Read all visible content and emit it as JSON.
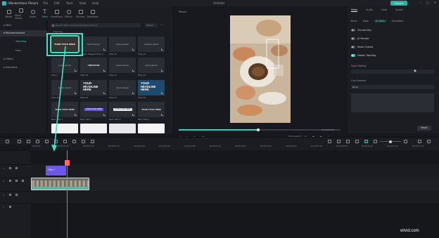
{
  "titlebar": {
    "app_name": "Wondershare Filmora",
    "menu": [
      "File",
      "Edit",
      "Tools",
      "View",
      "Help"
    ],
    "doc_title": "Untitled",
    "export_label": "Export"
  },
  "media_tabs": [
    {
      "label": "Media",
      "active": false
    },
    {
      "label": "Stock Media",
      "active": false
    },
    {
      "label": "Audio",
      "active": false
    },
    {
      "label": "Titles",
      "active": true
    },
    {
      "label": "Transitions",
      "active": false
    },
    {
      "label": "Effects",
      "active": false
    },
    {
      "label": "Stickers",
      "active": false
    },
    {
      "label": "Templates",
      "active": false
    }
  ],
  "left_panel": {
    "items": [
      "Mine",
      "Recommended",
      "Trending",
      "New",
      "Filters",
      "Elements"
    ],
    "selected": "Recommended",
    "active_sub": "Trending"
  },
  "library": {
    "search_placeholder": "Search titles from Wondershare Filmora",
    "price_filter": "Price",
    "section_header": "Trending",
    "thumbs": [
      {
        "caption": "YOUR TITLE HERE",
        "label": "",
        "selected": true
      },
      {
        "caption": "Lorem Ipsum",
        "label": "Classic Elegant Title 0...",
        "selected": false
      },
      {
        "caption": "Lorem ipsum",
        "label": "Title 33",
        "selected": false
      },
      {
        "caption": "+Dorem ipsum",
        "label": "Title_31",
        "selected": false
      },
      {
        "caption": "Lorem ipsum",
        "label": "Title_2",
        "selected": false
      },
      {
        "caption": "CREATION",
        "label": "Title 38",
        "selected": false
      },
      {
        "caption": "Lorem ipsum",
        "label": "Title 17",
        "selected": false
      },
      {
        "caption": "Lorem ipsum",
        "label": "Title_41",
        "selected": false
      },
      {
        "caption": "Lorem ipsum",
        "label": "Title 29",
        "selected": false
      },
      {
        "caption": "YOUR HEADLINE HERE",
        "label": "Title 46",
        "selected": false
      },
      {
        "caption": "Lorem ipsum",
        "label": "Title 44",
        "selected": false
      },
      {
        "caption": "YOUR HEADLINE HERE",
        "label": "Title 40",
        "selected": false
      },
      {
        "caption": "YOUR TITLE HERE",
        "label": "New Title 1",
        "selected": false
      },
      {
        "caption": "YOUR TITLE HERE",
        "label": "New Title 2",
        "selected": false
      },
      {
        "caption": "YOUR TITLE HERE",
        "label": "New Title 3",
        "selected": false
      },
      {
        "caption": "YOUR TITLE HERE",
        "label": "New Title 4",
        "selected": false
      }
    ]
  },
  "player": {
    "label": "Player",
    "time": "00:00:00:10",
    "quality": "Full Quality"
  },
  "properties": {
    "tabs": [
      "Video",
      "Audio",
      "Color",
      "Speed"
    ],
    "active_tab": "Video",
    "subtabs": [
      "Basic",
      "Mask",
      "AI Tools",
      "Animation"
    ],
    "active_subtab": "AI Tools",
    "rows": [
      "Chroma Key",
      "AI Portrait",
      "Smart Cutout",
      "Motion Tracking"
    ],
    "track_setting_label": "Track Setting",
    "link_element_label": "Link Element",
    "link_element_value": "None",
    "reset_label": "Reset"
  },
  "timeline": {
    "ruler_ticks": [
      "00:00:00",
      "00:00:00:10",
      "00:00:01:00",
      "00:00:01:10",
      "00:00:02:00",
      "00:00:02:10",
      "00:00:03:00",
      "00:00:03:10",
      "00:00:04:00",
      "00:00:04:10",
      "00:00:05:00",
      "00:00:05:10",
      "00:00:06:00",
      "00:00:06:10",
      "00:00:07:00",
      "00:00:07:10"
    ],
    "tracks": [
      "3",
      "2",
      "1",
      "1"
    ],
    "title_clip_label": "Title 1"
  },
  "watermark": "wtvid.com"
}
